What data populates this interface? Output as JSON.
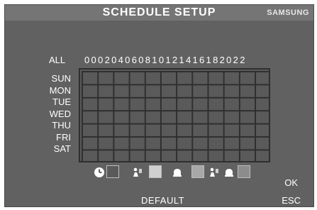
{
  "header": {
    "title": "SCHEDULE SETUP",
    "brand": "SAMSUNG"
  },
  "schedule": {
    "all_label": "ALL",
    "hours_text": "000204060810121416182022",
    "days": [
      "SUN",
      "MON",
      "TUE",
      "WED",
      "THU",
      "FRI",
      "SAT"
    ]
  },
  "legend": {
    "items": [
      {
        "icon": "clock-icon"
      },
      {
        "icon": "motion-person-icon",
        "swatch": "light-gray"
      },
      {
        "icon": "alarm-bell-icon",
        "swatch": "mid-gray"
      },
      {
        "icon": "motion-person-and-bell-icon",
        "swatch": "dark-gray"
      }
    ]
  },
  "buttons": {
    "ok": "OK",
    "default": "DEFAULT",
    "esc": "ESC"
  },
  "colors": {
    "panel": "#616161",
    "titlebar": "#757575",
    "cell": "#5a5a5a",
    "grid_line": "#2f2f2f"
  }
}
